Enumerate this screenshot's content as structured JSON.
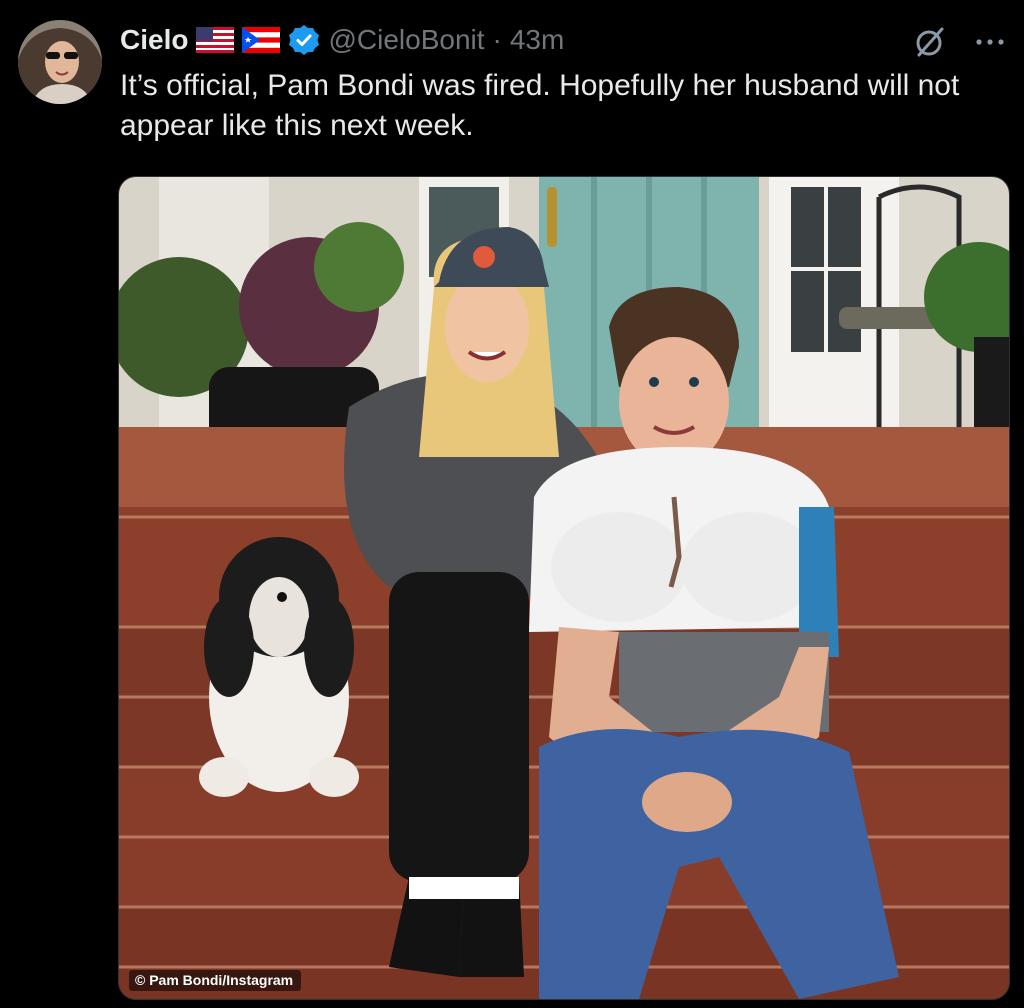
{
  "tweet": {
    "author_name": "Cielo",
    "flags": [
      "us-flag-icon",
      "puerto-rico-flag-icon"
    ],
    "verified": true,
    "handle": "@CieloBonit",
    "separator": "·",
    "time": "43m",
    "text": "It’s official, Pam Bondi was fired. Hopefully her husband will not appear like this next week."
  },
  "media": {
    "credit": "© Pam Bondi/Instagram"
  },
  "colors": {
    "background": "#000000",
    "text": "#e7e9ea",
    "secondary_text": "#71767b",
    "verified_badge": "#1d9bf0"
  }
}
